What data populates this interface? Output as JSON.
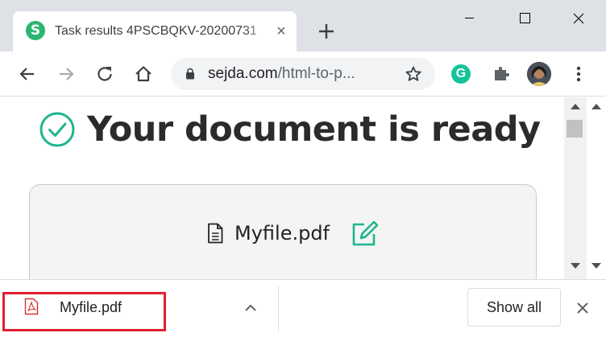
{
  "tab": {
    "favicon_letter": "S",
    "title": "Task results 4PSCBQKV-20200731",
    "close_glyph": "×"
  },
  "toolbar": {
    "url_host": "sejda.com",
    "url_path": "/html-to-p...",
    "grammarly_letter": "G"
  },
  "page": {
    "heading": "Your document is ready",
    "file_name": "Myfile.pdf",
    "accent_color": "#1fb58f"
  },
  "shelf": {
    "download_name": "Myfile.pdf",
    "show_all_label": "Show all",
    "highlight_color": "#e0202e"
  },
  "icons": [
    "back-icon",
    "forward-icon",
    "reload-icon",
    "home-icon",
    "lock-icon",
    "star-icon",
    "puzzle-icon",
    "kebab-icon",
    "check-circle-icon",
    "document-icon",
    "edit-icon",
    "pdf-icon",
    "chevron-up-icon",
    "close-icon"
  ]
}
